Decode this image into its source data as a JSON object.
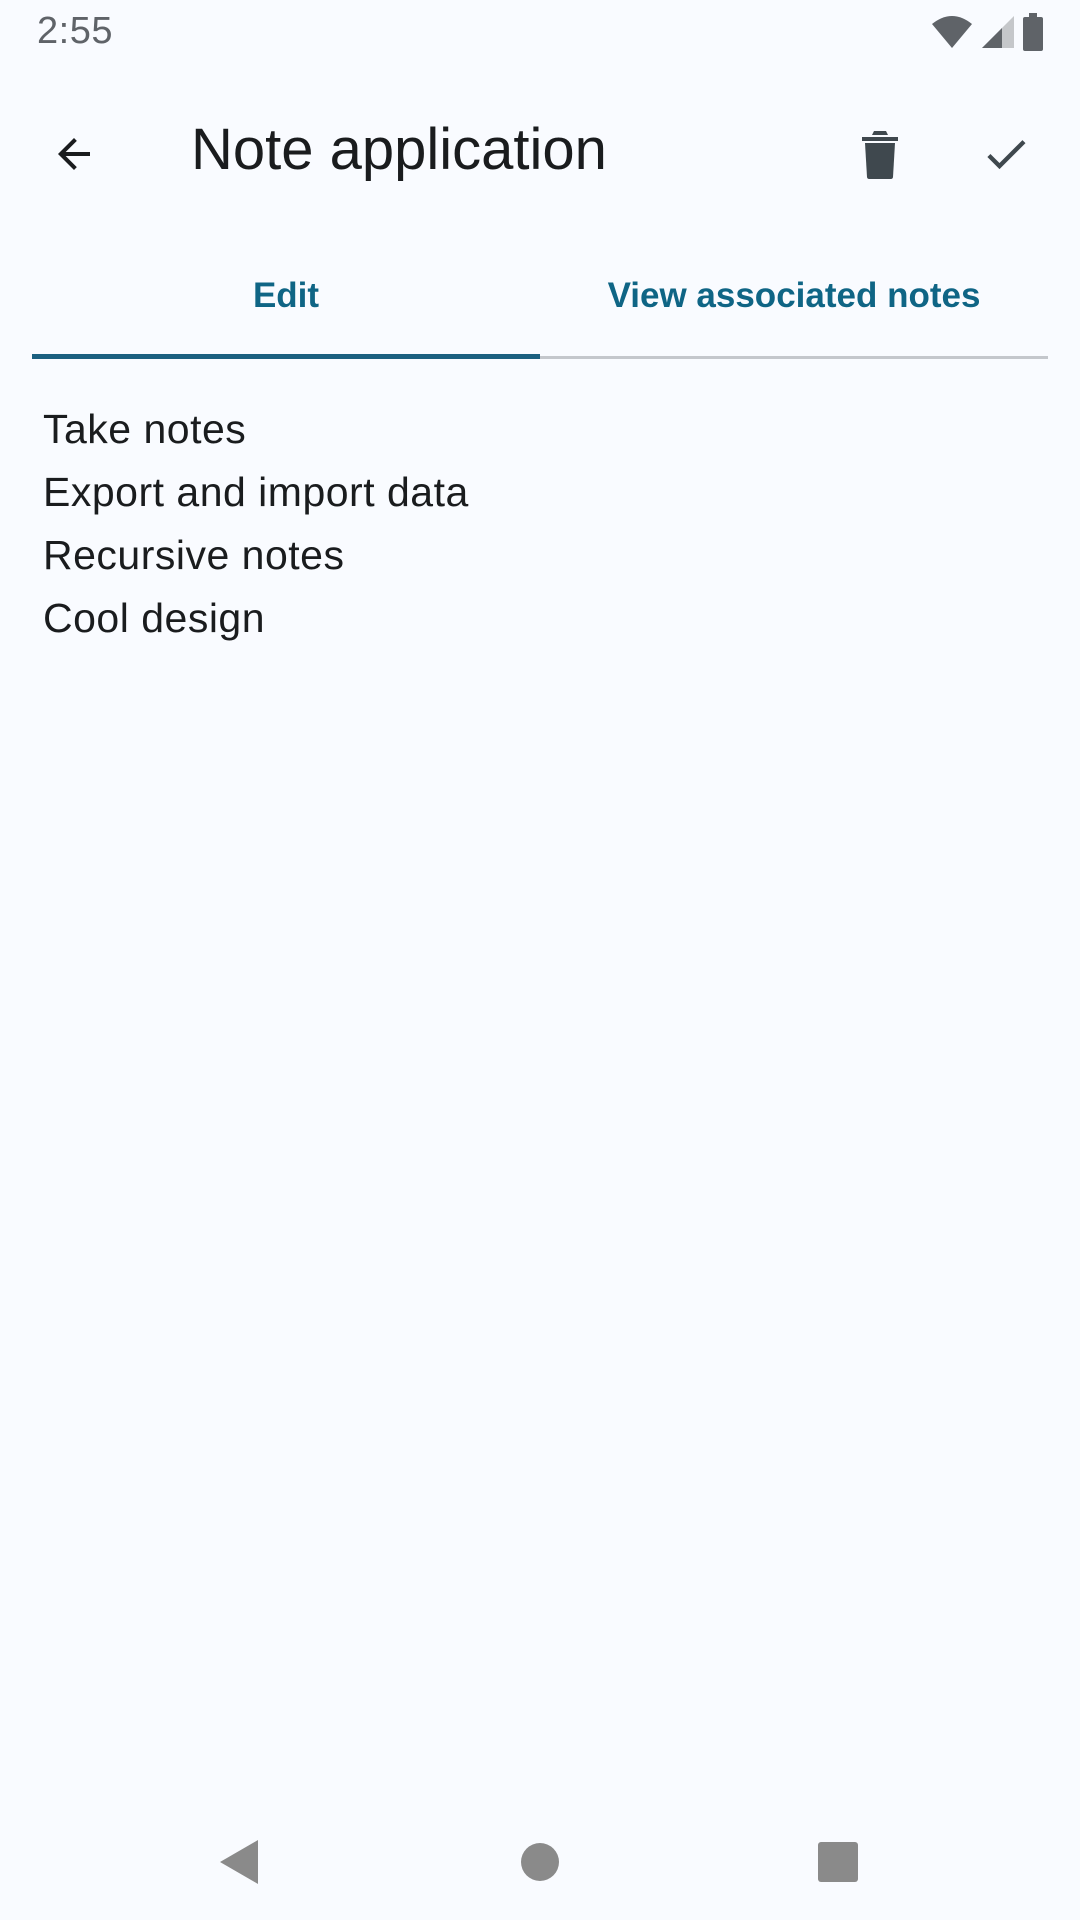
{
  "status_bar": {
    "time": "2:55",
    "icons": [
      "wifi-icon",
      "cell-signal-icon",
      "battery-icon"
    ]
  },
  "app_bar": {
    "title": "Note application",
    "back_icon": "arrow-back-icon",
    "delete_icon": "delete-icon",
    "confirm_icon": "check-icon"
  },
  "tabs": [
    {
      "label": "Edit",
      "active": true
    },
    {
      "label": "View associated notes",
      "active": false
    }
  ],
  "note": {
    "lines": [
      "Take notes",
      "Export and import data",
      "Recursive notes",
      "Cool design"
    ]
  },
  "nav_bar": {
    "icons": [
      "nav-back-icon",
      "nav-home-icon",
      "nav-recents-icon"
    ]
  },
  "colors": {
    "background": "#f9fbff",
    "accent": "#0f6585",
    "text": "#1a1c1e",
    "icon": "#3f484e"
  }
}
